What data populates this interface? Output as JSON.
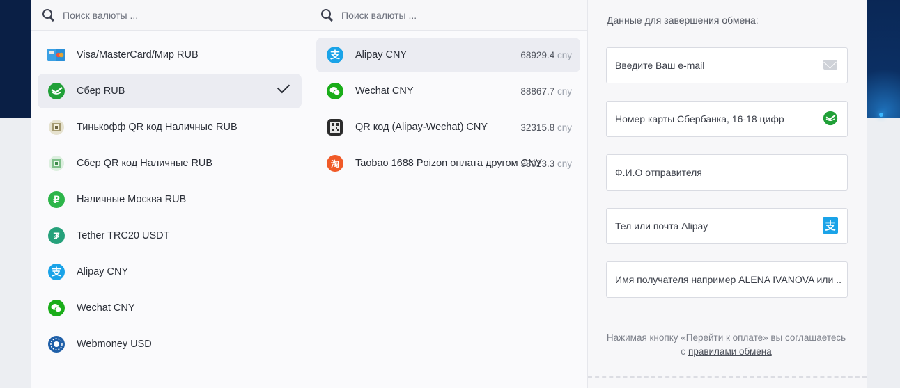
{
  "colors": {
    "accent": "#1a9cdc",
    "sber": "#21a038",
    "wechat": "#1aad19",
    "tether": "#26a17b",
    "alipay": "#1aa3e8"
  },
  "left": {
    "search_placeholder": "Поиск валюты ...",
    "items": [
      {
        "label": "Visa/MasterCard/Мир RUB",
        "icon": "card-icon"
      },
      {
        "label": "Сбер RUB",
        "icon": "sber-icon",
        "selected": true
      },
      {
        "label": "Тинькофф QR код Наличные RUB",
        "icon": "tinkoff-qr-icon"
      },
      {
        "label": "Сбер QR код Наличные RUB",
        "icon": "sber-qr-icon"
      },
      {
        "label": "Наличные Москва RUB",
        "icon": "ruble-icon"
      },
      {
        "label": "Tether TRC20 USDT",
        "icon": "tether-icon"
      },
      {
        "label": "Alipay CNY",
        "icon": "alipay-icon"
      },
      {
        "label": "Wechat CNY",
        "icon": "wechat-icon"
      },
      {
        "label": "Webmoney USD",
        "icon": "webmoney-icon"
      }
    ]
  },
  "middle": {
    "search_placeholder": "Поиск валюты ...",
    "items": [
      {
        "label": "Alipay CNY",
        "amount": "68929.4",
        "unit": "cny",
        "icon": "alipay-icon",
        "selected": true
      },
      {
        "label": "Wechat CNY",
        "amount": "88867.7",
        "unit": "cny",
        "icon": "wechat-icon"
      },
      {
        "label": "QR код (Alipay-Wechat) CNY",
        "amount": "32315.8",
        "unit": "cny",
        "icon": "qr-code-icon"
      },
      {
        "label": "Taobao 1688 Poizon оплата другом CNY",
        "amount": "98023.3",
        "unit": "cny",
        "icon": "taobao-icon"
      }
    ]
  },
  "form": {
    "title": "Данные для завершения обмена:",
    "email_placeholder": "Введите Ваш e-mail",
    "card_placeholder": "Номер карты Сбербанка, 16-18 цифр",
    "sender_placeholder": "Ф.И.О отправителя",
    "alipay_placeholder": "Тел или почта Alipay",
    "recipient_placeholder": "Имя получателя например ALENA IVANOVA или ...",
    "agree_text": "Нажимая кнопку «Перейти к оплате» вы соглашаетесь с",
    "rules_link": "правилами обмена"
  }
}
